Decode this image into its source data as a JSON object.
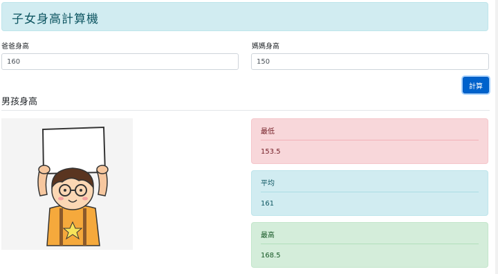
{
  "header": {
    "title": "子女身高計算機"
  },
  "form": {
    "father_label": "爸爸身高",
    "father_value": "160",
    "mother_label": "媽媽身高",
    "mother_value": "150",
    "calc_button": "計算"
  },
  "result": {
    "section_title": "男孩身高",
    "illustration": "boy-holding-sign",
    "cards": [
      {
        "label": "最低",
        "value": "153.5",
        "color": "#f8d7da"
      },
      {
        "label": "平均",
        "value": "161",
        "color": "#d1ecf1"
      },
      {
        "label": "最高",
        "value": "168.5",
        "color": "#d4edda"
      }
    ]
  }
}
